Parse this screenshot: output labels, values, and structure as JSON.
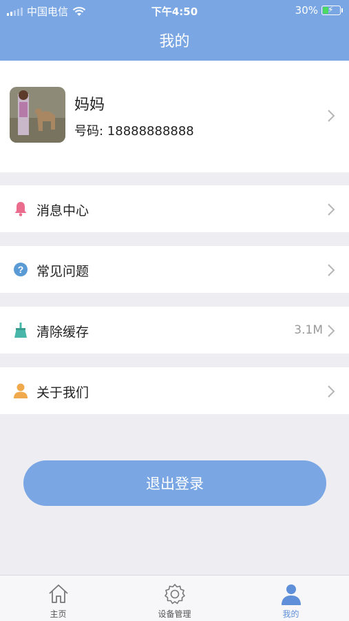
{
  "status_bar": {
    "carrier": "中国电信",
    "time": "下午4:50",
    "battery": "30%"
  },
  "header": {
    "title": "我的"
  },
  "profile": {
    "name": "妈妈",
    "phone_label": "号码: 18888888888"
  },
  "menu": [
    {
      "label": "消息中心",
      "icon": "bell-icon",
      "value": ""
    },
    {
      "label": "常见问题",
      "icon": "question-icon",
      "value": ""
    },
    {
      "label": "清除缓存",
      "icon": "broom-icon",
      "value": "3.1M"
    },
    {
      "label": "关于我们",
      "icon": "person-icon",
      "value": ""
    }
  ],
  "logout": {
    "label": "退出登录"
  },
  "tabbar": {
    "items": [
      {
        "label": "主页",
        "icon": "home-icon"
      },
      {
        "label": "设备管理",
        "icon": "gear-icon"
      },
      {
        "label": "我的",
        "icon": "user-icon",
        "active": true
      }
    ]
  },
  "colors": {
    "primary": "#7aa7e4",
    "bell": "#ea6d8e",
    "question": "#5b9bd5",
    "broom": "#48b6a8",
    "person": "#f0a94c",
    "tab_active": "#5e8fd8"
  }
}
